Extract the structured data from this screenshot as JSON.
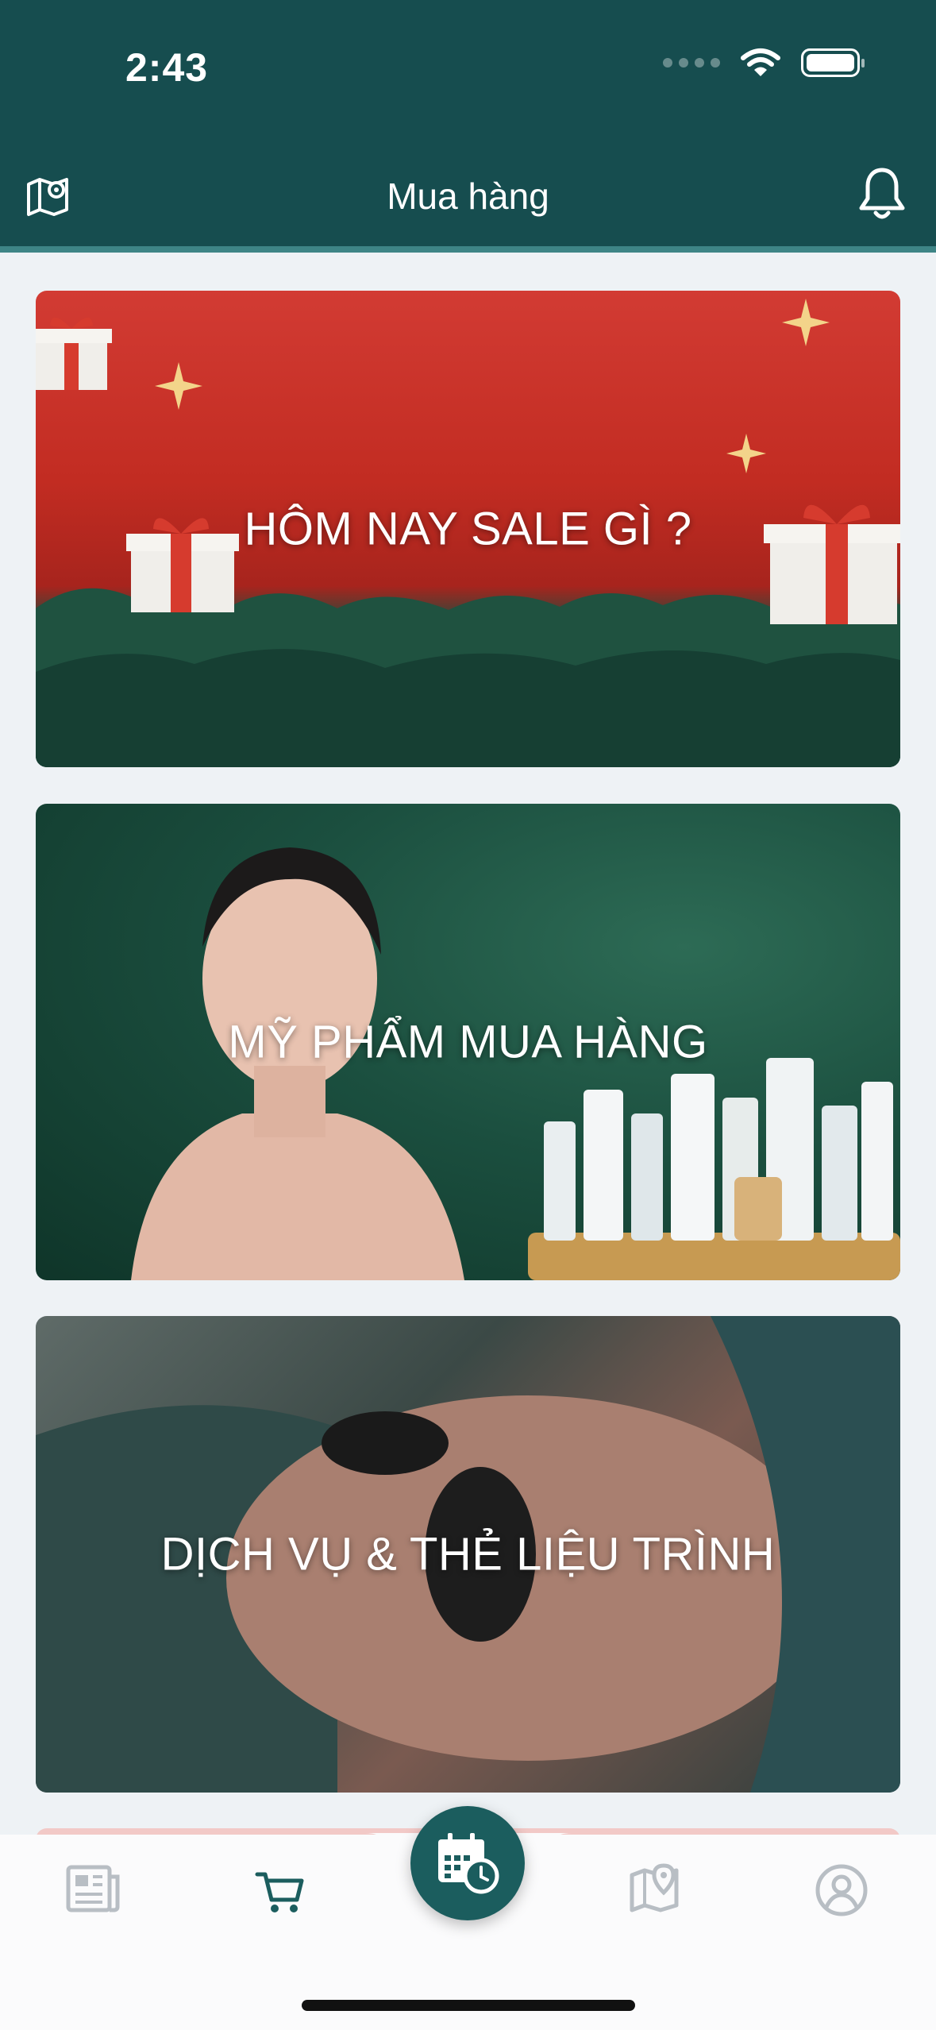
{
  "status_bar": {
    "time": "2:43"
  },
  "header": {
    "title": "Mua hàng"
  },
  "cards": [
    {
      "label": "HÔM NAY SALE GÌ ?"
    },
    {
      "label": "MỸ PHẨM MUA HÀNG"
    },
    {
      "label": "DỊCH VỤ & THẺ LIỆU TRÌNH"
    }
  ],
  "tab_bar": {
    "tabs": [
      {
        "icon": "newspaper-icon"
      },
      {
        "icon": "cart-icon",
        "active": true
      },
      {
        "icon": "calendar-clock-icon"
      },
      {
        "icon": "map-pin-icon"
      },
      {
        "icon": "profile-icon"
      }
    ]
  },
  "colors": {
    "header": "#164d4f",
    "accent": "#1b5d5e",
    "background": "#eef2f5"
  }
}
